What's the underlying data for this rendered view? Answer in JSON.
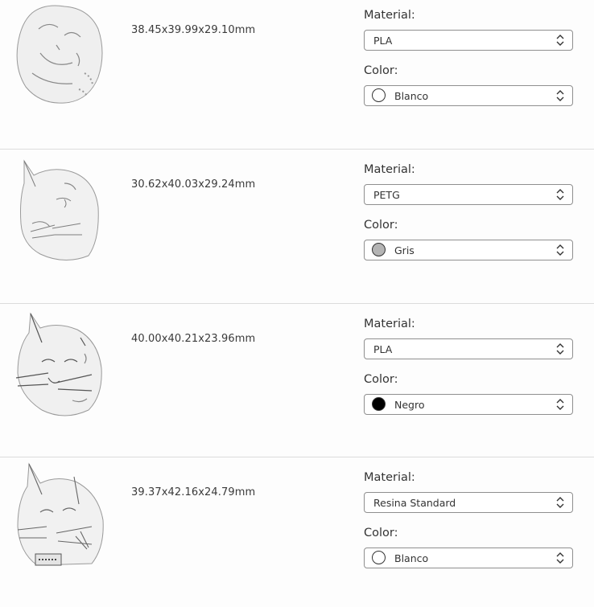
{
  "labels": {
    "material": "Material:",
    "color": "Color:"
  },
  "items": [
    {
      "dims": "38.45x39.99x29.10mm",
      "material": "PLA",
      "color": "Blanco",
      "swatch": "#ffffff"
    },
    {
      "dims": "30.62x40.03x29.24mm",
      "material": "PETG",
      "color": "Gris",
      "swatch": "#b4b4b4"
    },
    {
      "dims": "40.00x40.21x23.96mm",
      "material": "PLA",
      "color": "Negro",
      "swatch": "#000000"
    },
    {
      "dims": "39.37x42.16x24.79mm",
      "material": "Resina Standard",
      "color": "Blanco",
      "swatch": "#ffffff"
    }
  ]
}
